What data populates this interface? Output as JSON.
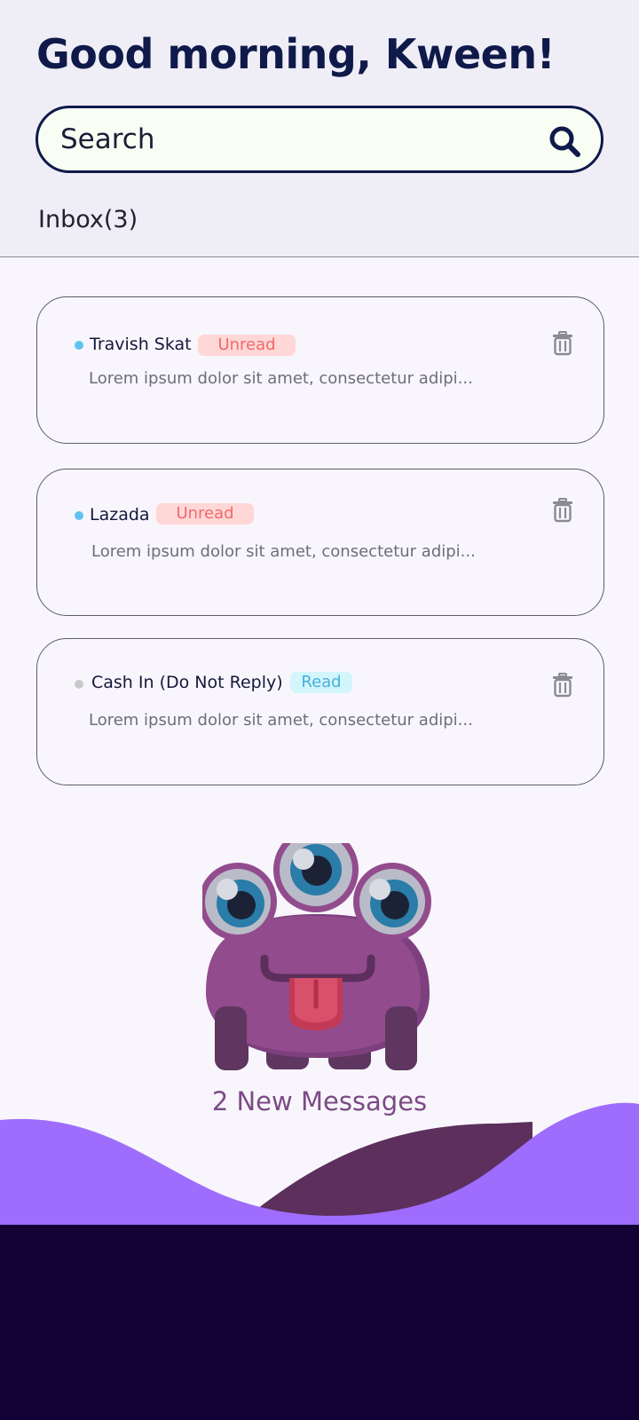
{
  "header": {
    "greeting": "Good morning, Kween!",
    "search": {
      "placeholder": "Search"
    },
    "inbox_label": "Inbox(3)"
  },
  "messages": [
    {
      "sender": "Travish Skat",
      "status": "Unread",
      "preview": "Lorem ipsum dolor sit amet, consectetur adipi...",
      "dot_color": "#5fc3ef"
    },
    {
      "sender": "Lazada",
      "status": "Unread",
      "preview": "Lorem ipsum dolor sit amet, consectetur adipi...",
      "dot_color": "#5fc3ef"
    },
    {
      "sender": "Cash In (Do Not Reply)",
      "status": "Read",
      "preview": "Lorem ipsum dolor sit amet, consectetur adipi...",
      "dot_color": "#c9c9cc"
    }
  ],
  "new_messages_label": "2 New Messages",
  "colors": {
    "primary": "#0f1a4a",
    "wave": "#9e6dfe",
    "wave_dark": "#5c2f5c",
    "footer": "#130035",
    "unread_badge": "#ffd7d7",
    "read_badge": "#d2f6fb"
  },
  "icons": {
    "search": "search-icon",
    "delete": "trash-icon",
    "mascot": "monster-illustration"
  }
}
